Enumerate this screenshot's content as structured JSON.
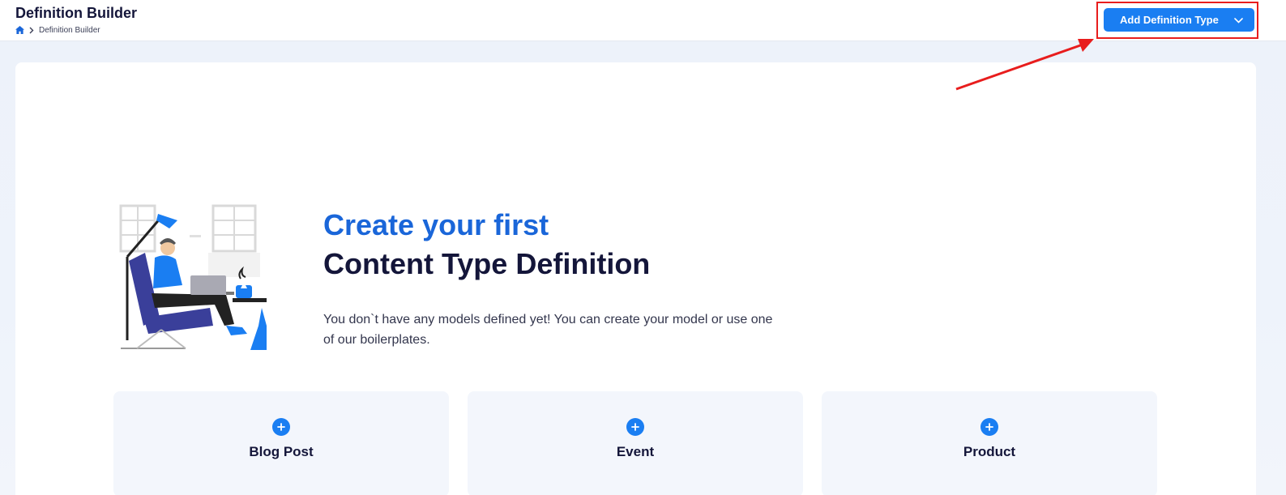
{
  "header": {
    "title": "Definition Builder",
    "breadcrumb": {
      "home_icon": "home-icon",
      "separator_icon": "chevron-right-icon",
      "current": "Definition Builder"
    },
    "add_button": {
      "label": "Add Definition Type",
      "icon": "chevron-down-icon"
    }
  },
  "hero": {
    "title_line_1": "Create your first",
    "title_line_2": "Content Type Definition",
    "description": "You don`t have any models defined yet! You can create your model or use one of our boilerplates."
  },
  "boilerplates": [
    {
      "label": "Blog Post",
      "icon": "plus-icon"
    },
    {
      "label": "Event",
      "icon": "plus-icon"
    },
    {
      "label": "Product",
      "icon": "plus-icon"
    }
  ],
  "colors": {
    "accent": "#1a7ef2",
    "title_blue": "#1a66d9",
    "text_dark": "#14163a",
    "annotation_red": "#e81d1d"
  }
}
